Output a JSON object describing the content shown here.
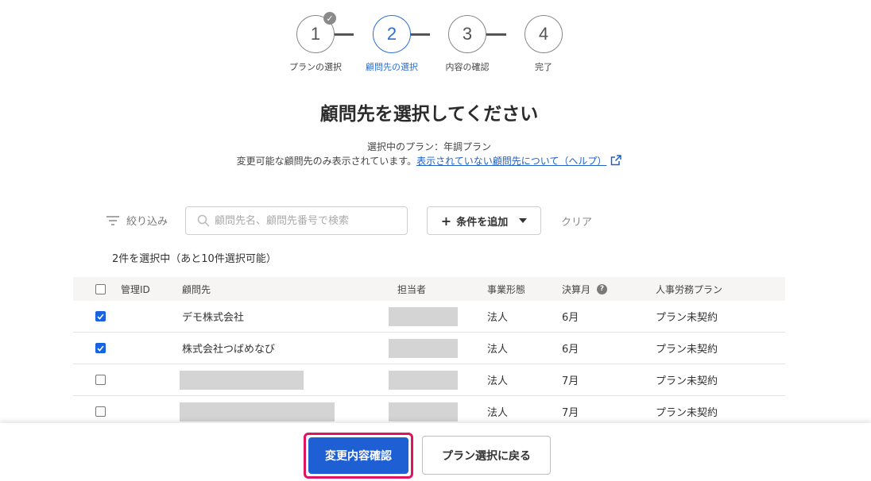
{
  "stepper": {
    "steps": [
      {
        "number": "1",
        "label": "プランの選択",
        "state": "completed"
      },
      {
        "number": "2",
        "label": "顧問先の選択",
        "state": "active"
      },
      {
        "number": "3",
        "label": "内容の確認",
        "state": "pending"
      },
      {
        "number": "4",
        "label": "完了",
        "state": "pending"
      }
    ]
  },
  "header": {
    "title": "顧問先を選択してください",
    "plan_line": "選択中のプラン：年調プラン",
    "help_prefix": "変更可能な顧問先のみ表示されています。",
    "help_link": "表示されていない顧問先について（ヘルプ）"
  },
  "filter": {
    "label": "絞り込み",
    "search_placeholder": "顧問先名、顧問先番号で検索",
    "add_condition": "条件を追加",
    "clear": "クリア"
  },
  "selection_count": "2件を選択中（あと10件選択可能）",
  "table": {
    "headers": {
      "id": "管理ID",
      "client": "顧問先",
      "staff": "担当者",
      "business_type": "事業形態",
      "fiscal_month": "決算月",
      "hr_plan": "人事労務プラン"
    },
    "rows": [
      {
        "checked": true,
        "id": "",
        "client": "デモ株式会社",
        "business_type": "法人",
        "fiscal_month": "6月",
        "hr_plan": "プラン未契約"
      },
      {
        "checked": true,
        "id": "",
        "client": "株式会社つばめなび",
        "business_type": "法人",
        "fiscal_month": "6月",
        "hr_plan": "プラン未契約"
      },
      {
        "checked": false,
        "id": "",
        "client": "",
        "business_type": "法人",
        "fiscal_month": "7月",
        "hr_plan": "プラン未契約"
      },
      {
        "checked": false,
        "id": "",
        "client": "",
        "business_type": "法人",
        "fiscal_month": "7月",
        "hr_plan": "プラン未契約"
      }
    ]
  },
  "footer": {
    "confirm_label": "変更内容確認",
    "back_label": "プラン選択に戻る"
  },
  "colors": {
    "accent": "#2b6fd6",
    "primary_button": "#1f5fd4",
    "highlight_border": "#e0135f",
    "redaction": "#d4d4d4"
  }
}
